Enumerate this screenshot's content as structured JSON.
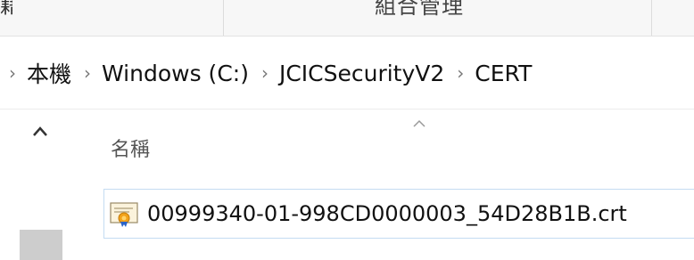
{
  "ribbon": {
    "cut_left_glyph": "籍",
    "group_label": "組合管理"
  },
  "breadcrumb": {
    "items": [
      "本機",
      "Windows (C:)",
      "JCICSecurityV2",
      "CERT"
    ]
  },
  "columns": {
    "name_header": "名稱",
    "sort_icon": "sort-ascending-icon"
  },
  "files": [
    {
      "name": "00999340-01-998CD0000003_54D28B1B.crt",
      "icon": "certificate-icon"
    }
  ],
  "colors": {
    "selection_border": "#c4dcf2",
    "ribbon_bg": "#f7f7f7"
  }
}
